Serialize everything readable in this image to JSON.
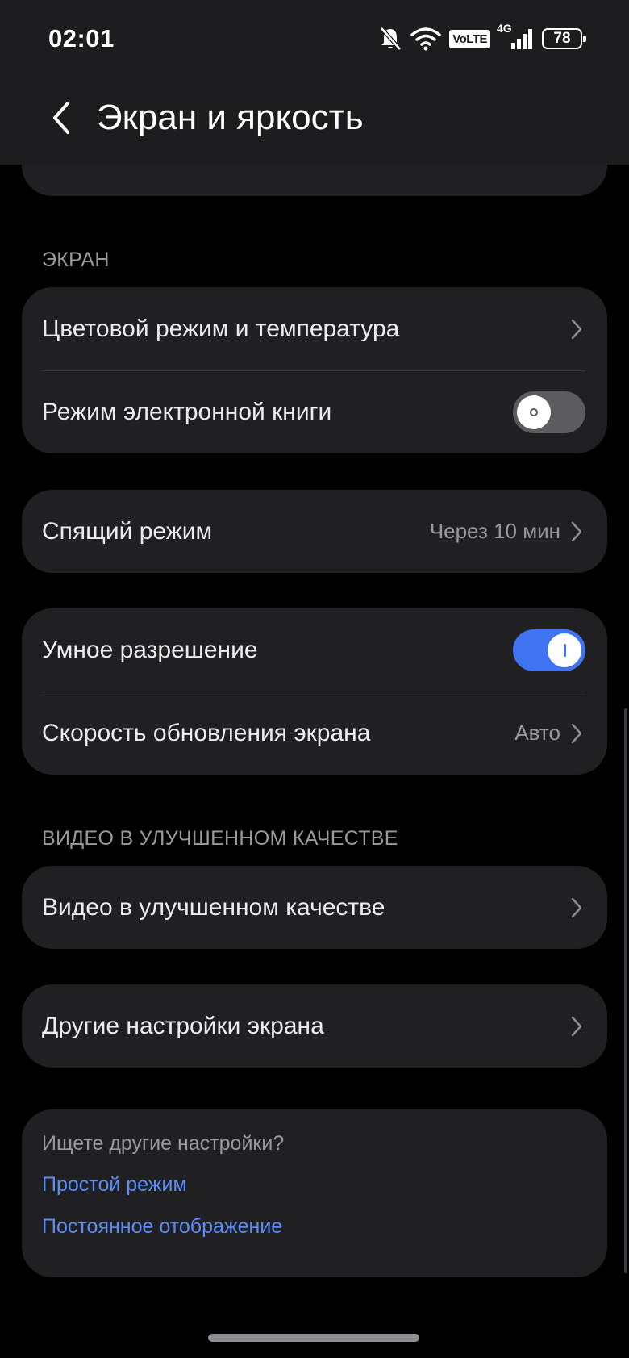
{
  "status_bar": {
    "time": "02:01",
    "volte_label": "VoLTE",
    "network_label": "4G",
    "battery_level": "78",
    "icons": [
      "mute-bell-icon",
      "wifi-icon",
      "volte-icon",
      "cellular-signal-icon",
      "battery-icon"
    ]
  },
  "header": {
    "title": "Экран и яркость",
    "back_icon": "chevron-left-icon"
  },
  "sections": {
    "screen_header": "ЭКРАН",
    "video_header": "ВИДЕО В УЛУЧШЕННОМ КАЧЕСТВЕ"
  },
  "screen_card": {
    "color_mode_label": "Цветовой режим и температура",
    "ebook_mode_label": "Режим электронной книги",
    "ebook_mode_enabled": false
  },
  "sleep_card": {
    "label": "Спящий режим",
    "value": "Через 10 мин"
  },
  "resolution_card": {
    "smart_resolution_label": "Умное разрешение",
    "smart_resolution_enabled": true,
    "refresh_rate_label": "Скорость обновления экрана",
    "refresh_rate_value": "Авто"
  },
  "video_card": {
    "label": "Видео в улучшенном качестве"
  },
  "other_card": {
    "label": "Другие настройки экрана"
  },
  "search_card": {
    "title": "Ищете другие настройки?",
    "links": [
      "Простой режим",
      "Постоянное отображение"
    ]
  },
  "colors": {
    "background": "#000000",
    "card": "#202022",
    "accent": "#3f73f2",
    "link": "#5b8cf8"
  }
}
